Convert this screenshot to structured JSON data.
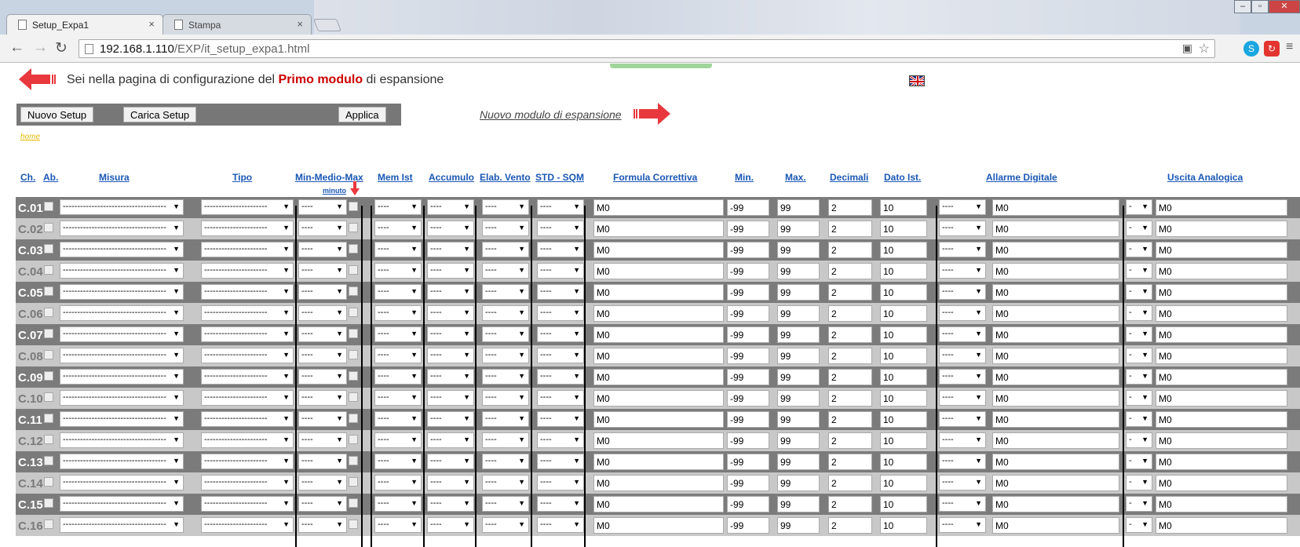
{
  "browser": {
    "tabs": [
      {
        "label": "Setup_Expa1",
        "close": "×"
      },
      {
        "label": "Stampa",
        "close": "×"
      }
    ],
    "url_host": "192.168.1.110",
    "url_path": "/EXP/it_setup_expa1.html",
    "window_buttons": [
      "–",
      "▫",
      "✕"
    ]
  },
  "header": {
    "text_before": "Sei nella pagina di configurazione del ",
    "highlight": "Primo modulo",
    "text_after": " di espansione"
  },
  "buttons": {
    "new_setup": "Nuovo Setup",
    "load_setup": "Carica Setup",
    "apply": "Applica"
  },
  "new_module_link": "Nuovo modulo di espansione",
  "home_link": "home",
  "columns": {
    "ch": "Ch.",
    "ab": "Ab.",
    "misura": "Misura",
    "tipo": "Tipo",
    "minmediomax": "Min-Medio-Max",
    "minuto": "minuto",
    "memist": "Mem Ist",
    "accumulo": "Accumulo",
    "elabvento": "Elab. Vento",
    "stdsqm": "STD - SQM",
    "formula": "Formula Correttiva",
    "min": "Min.",
    "max": "Max.",
    "decimali": "Decimali",
    "datoist": "Dato Ist.",
    "allarme": "Allarme Digitale",
    "uscita": "Uscita Analogica"
  },
  "row_defaults": {
    "misura": "------------------------------------",
    "tipo": "----------------------",
    "dash": "----",
    "formula": "M0",
    "min": "-99",
    "max": "99",
    "decimali": "2",
    "datoist": "10",
    "allarme_sel": "----",
    "allarme_val": "M0",
    "uscita_sel": "-",
    "uscita_val": "M0"
  },
  "channels": [
    "C.01",
    "C.02",
    "C.03",
    "C.04",
    "C.05",
    "C.06",
    "C.07",
    "C.08",
    "C.09",
    "C.10",
    "C.11",
    "C.12",
    "C.13",
    "C.14",
    "C.15",
    "C.16"
  ],
  "colors": {
    "accent_red": "#e8383d",
    "link_blue": "#1a57b5",
    "row_dark": "#7b7b7b",
    "row_light": "#c8c8c8"
  }
}
